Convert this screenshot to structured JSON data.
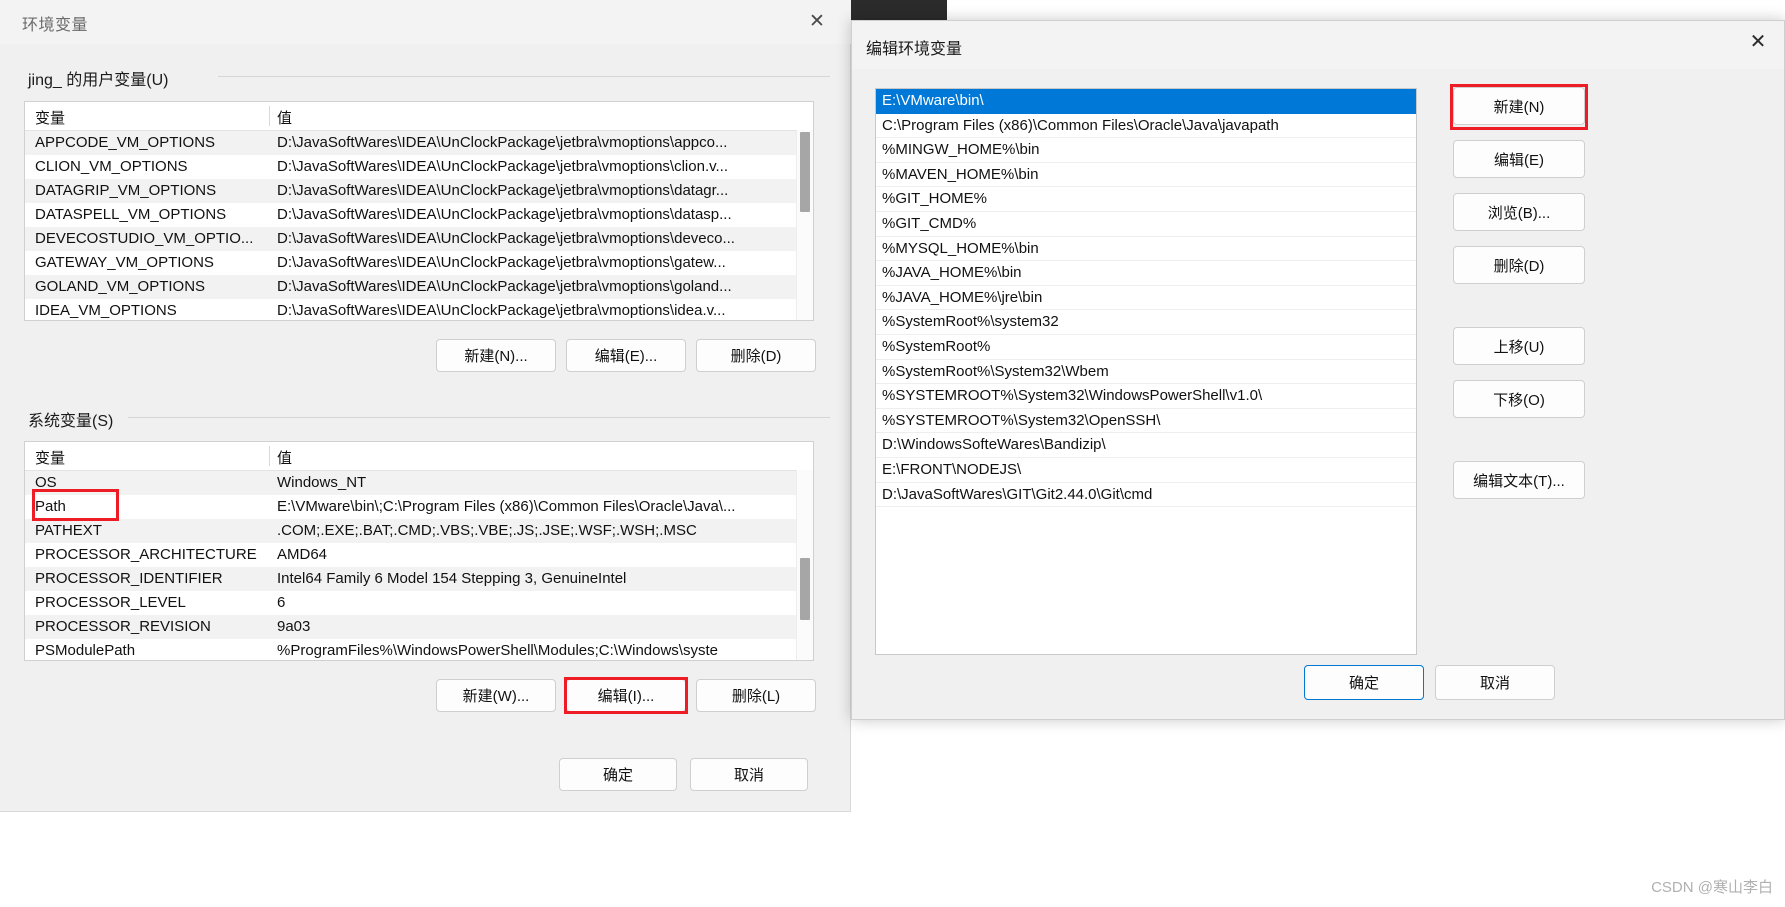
{
  "env_dialog": {
    "title": "环境变量",
    "close_icon": "✕",
    "user_section": {
      "label": "jing_ 的用户变量(U)",
      "columns": [
        "变量",
        "值"
      ],
      "rows": [
        {
          "name": "APPCODE_VM_OPTIONS",
          "value": "D:\\JavaSoftWares\\IDEA\\UnClockPackage\\jetbra\\vmoptions\\appco..."
        },
        {
          "name": "CLION_VM_OPTIONS",
          "value": "D:\\JavaSoftWares\\IDEA\\UnClockPackage\\jetbra\\vmoptions\\clion.v..."
        },
        {
          "name": "DATAGRIP_VM_OPTIONS",
          "value": "D:\\JavaSoftWares\\IDEA\\UnClockPackage\\jetbra\\vmoptions\\datagr..."
        },
        {
          "name": "DATASPELL_VM_OPTIONS",
          "value": "D:\\JavaSoftWares\\IDEA\\UnClockPackage\\jetbra\\vmoptions\\datasp..."
        },
        {
          "name": "DEVECOSTUDIO_VM_OPTIO...",
          "value": "D:\\JavaSoftWares\\IDEA\\UnClockPackage\\jetbra\\vmoptions\\deveco..."
        },
        {
          "name": "GATEWAY_VM_OPTIONS",
          "value": "D:\\JavaSoftWares\\IDEA\\UnClockPackage\\jetbra\\vmoptions\\gatew..."
        },
        {
          "name": "GOLAND_VM_OPTIONS",
          "value": "D:\\JavaSoftWares\\IDEA\\UnClockPackage\\jetbra\\vmoptions\\goland..."
        },
        {
          "name": "IDEA_VM_OPTIONS",
          "value": "D:\\JavaSoftWares\\IDEA\\UnClockPackage\\jetbra\\vmoptions\\idea.v..."
        }
      ],
      "buttons": {
        "new": "新建(N)...",
        "edit": "编辑(E)...",
        "delete": "删除(D)"
      }
    },
    "system_section": {
      "label": "系统变量(S)",
      "columns": [
        "变量",
        "值"
      ],
      "rows": [
        {
          "name": "OS",
          "value": "Windows_NT"
        },
        {
          "name": "Path",
          "value": "E:\\VMware\\bin\\;C:\\Program Files (x86)\\Common Files\\Oracle\\Java\\..."
        },
        {
          "name": "PATHEXT",
          "value": ".COM;.EXE;.BAT;.CMD;.VBS;.VBE;.JS;.JSE;.WSF;.WSH;.MSC"
        },
        {
          "name": "PROCESSOR_ARCHITECTURE",
          "value": "AMD64"
        },
        {
          "name": "PROCESSOR_IDENTIFIER",
          "value": "Intel64 Family 6 Model 154 Stepping 3, GenuineIntel"
        },
        {
          "name": "PROCESSOR_LEVEL",
          "value": "6"
        },
        {
          "name": "PROCESSOR_REVISION",
          "value": "9a03"
        },
        {
          "name": "PSModulePath",
          "value": "%ProgramFiles%\\WindowsPowerShell\\Modules;C:\\Windows\\syste"
        }
      ],
      "buttons": {
        "new": "新建(W)...",
        "edit": "编辑(I)...",
        "delete": "删除(L)"
      }
    },
    "footer": {
      "ok": "确定",
      "cancel": "取消"
    }
  },
  "edit_dialog": {
    "title": "编辑环境变量",
    "close_icon": "✕",
    "path_entries": [
      "E:\\VMware\\bin\\",
      "C:\\Program Files (x86)\\Common Files\\Oracle\\Java\\javapath",
      "%MINGW_HOME%\\bin",
      "%MAVEN_HOME%\\bin",
      "%GIT_HOME%",
      "%GIT_CMD%",
      "%MYSQL_HOME%\\bin",
      "%JAVA_HOME%\\bin",
      "%JAVA_HOME%\\jre\\bin",
      "%SystemRoot%\\system32",
      "%SystemRoot%",
      "%SystemRoot%\\System32\\Wbem",
      "%SYSTEMROOT%\\System32\\WindowsPowerShell\\v1.0\\",
      "%SYSTEMROOT%\\System32\\OpenSSH\\",
      "D:\\WindowsSofteWares\\Bandizip\\",
      "E:\\FRONT\\NODEJS\\",
      "D:\\JavaSoftWares\\GIT\\Git2.44.0\\Git\\cmd"
    ],
    "selected_index": 0,
    "side_buttons": [
      {
        "label": "新建(N)",
        "name": "new"
      },
      {
        "label": "编辑(E)",
        "name": "edit"
      },
      {
        "label": "浏览(B)...",
        "name": "browse"
      },
      {
        "label": "删除(D)",
        "name": "delete"
      },
      {
        "label": "上移(U)",
        "name": "move-up"
      },
      {
        "label": "下移(O)",
        "name": "move-down"
      },
      {
        "label": "编辑文本(T)...",
        "name": "edit-text"
      }
    ],
    "footer": {
      "ok": "确定",
      "cancel": "取消"
    }
  },
  "watermark": "CSDN @寒山李白",
  "colors": {
    "accent": "#0078d7",
    "annotation": "#ee1c25",
    "dialog_bg": "#f0f0f0"
  }
}
